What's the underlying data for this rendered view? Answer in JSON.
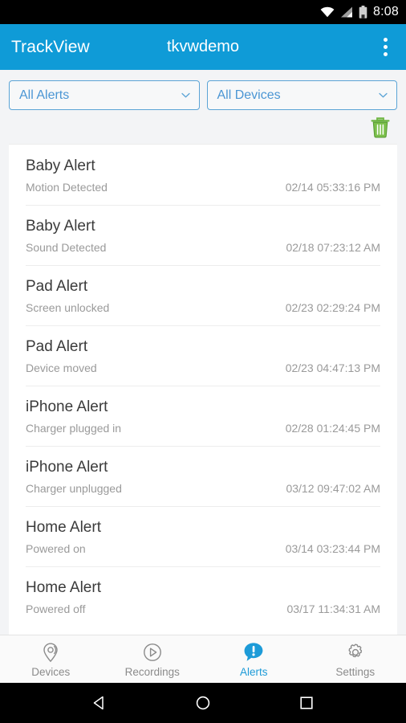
{
  "statusbar": {
    "time": "8:08",
    "icons": [
      "wifi-icon",
      "cellular-signal-icon",
      "battery-icon"
    ]
  },
  "appbar": {
    "title": "TrackView",
    "account": "tkvwdemo",
    "overflow_label": "overflow-menu"
  },
  "filters": {
    "alert_filter": {
      "value": "All Alerts",
      "chevron": "chevron-down-icon"
    },
    "device_filter": {
      "value": "All Devices",
      "chevron": "chevron-down-icon"
    },
    "delete_icon": "trash-icon",
    "accent_blue": "#4b96d4",
    "border_blue": "#5ba4d6",
    "trash_green": "#6fb643"
  },
  "alerts": [
    {
      "title": "Baby Alert",
      "description": "Motion Detected",
      "timestamp": "02/14 05:33:16 PM"
    },
    {
      "title": "Baby Alert",
      "description": "Sound Detected",
      "timestamp": "02/18 07:23:12 AM"
    },
    {
      "title": "Pad Alert",
      "description": "Screen unlocked",
      "timestamp": "02/23 02:29:24 PM"
    },
    {
      "title": "Pad Alert",
      "description": "Device moved",
      "timestamp": "02/23 04:47:13 PM"
    },
    {
      "title": "iPhone Alert",
      "description": "Charger plugged in",
      "timestamp": "02/28 01:24:45 PM"
    },
    {
      "title": "iPhone Alert",
      "description": "Charger unplugged",
      "timestamp": "03/12 09:47:02 AM"
    },
    {
      "title": "Home Alert",
      "description": "Powered on",
      "timestamp": "03/14 03:23:44 PM"
    },
    {
      "title": "Home Alert",
      "description": "Powered off",
      "timestamp": "03/17 11:34:31 AM"
    }
  ],
  "bottomnav": {
    "active": "Alerts",
    "active_color": "#1d9bd8",
    "items": [
      {
        "label": "Devices",
        "icon": "location-pin-icon"
      },
      {
        "label": "Recordings",
        "icon": "play-circle-icon"
      },
      {
        "label": "Alerts",
        "icon": "alert-bubble-icon"
      },
      {
        "label": "Settings",
        "icon": "gear-icon"
      }
    ]
  },
  "sysnav": {
    "back": "back-triangle-icon",
    "home": "home-circle-icon",
    "recents": "recents-square-icon"
  },
  "theme": {
    "appbar_blue": "#0f9bd7",
    "page_bg": "#f3f4f6",
    "card_bg": "#ffffff"
  }
}
